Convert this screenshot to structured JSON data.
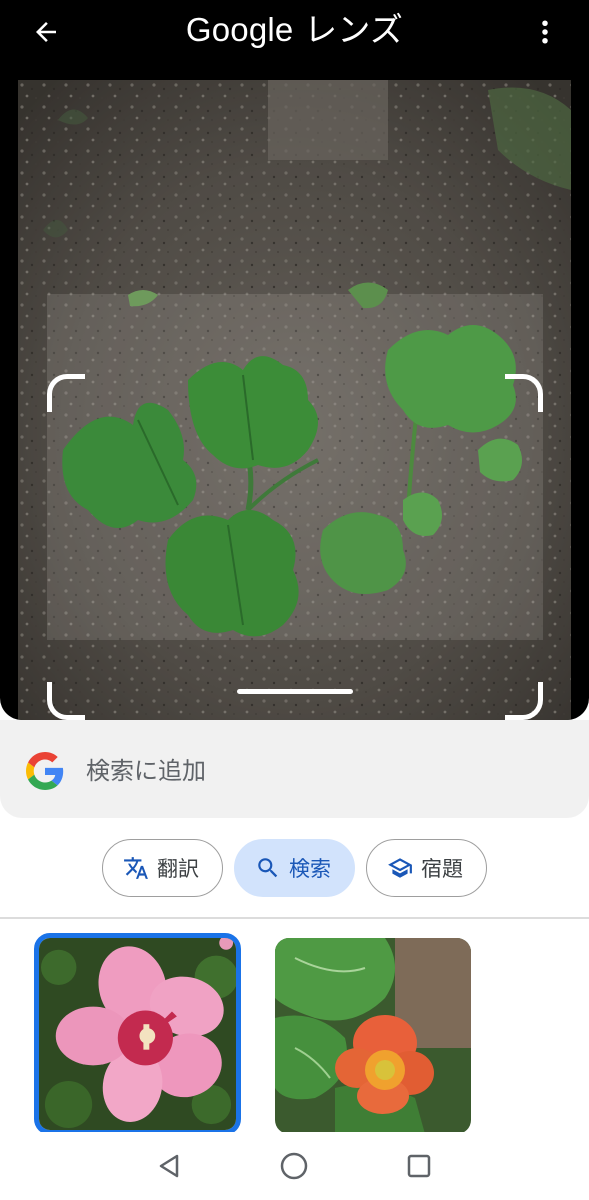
{
  "header": {
    "title_brand": "Google",
    "title_suffix": " レンズ"
  },
  "search_bar": {
    "label": "検索に追加"
  },
  "modes": [
    {
      "label": "翻訳",
      "icon": "translate-icon",
      "selected": false
    },
    {
      "label": "検索",
      "icon": "search-icon",
      "selected": true
    },
    {
      "label": "宿題",
      "icon": "graduation-cap-icon",
      "selected": false
    }
  ],
  "results": [
    {
      "subject": "pink hibiscus flower",
      "selected": true
    },
    {
      "subject": "orange flower with green leaves",
      "selected": false
    }
  ],
  "navigation": {
    "back": "back-triangle-icon",
    "home": "home-circle-icon",
    "recents": "recents-square-icon"
  },
  "colors": {
    "accent": "#1a73e8",
    "chip_selected_bg": "#d2e3fc",
    "chip_selected_text": "#1a57b7",
    "topbar_bg": "#000000"
  }
}
